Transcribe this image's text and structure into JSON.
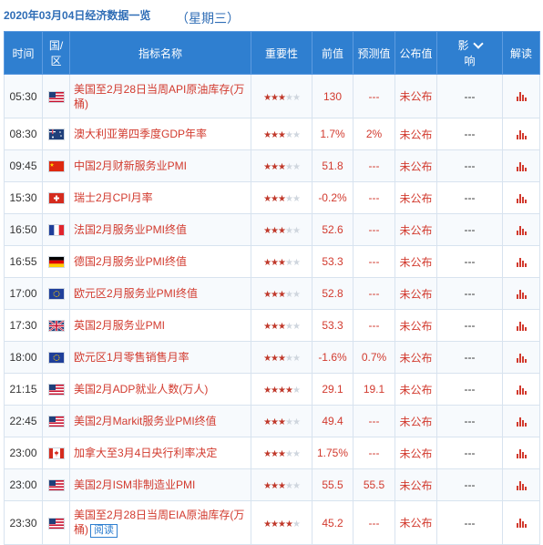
{
  "header": {
    "date": "2020年03月04日经济数据一览",
    "weekday": "（星期三）"
  },
  "columns": {
    "time": "时间",
    "country_l1": "国/",
    "country_l2": "区",
    "indicator": "指标名称",
    "importance": "重要性",
    "previous": "前值",
    "forecast": "预测值",
    "actual": "公布值",
    "impact_l1": "影",
    "impact_l2": "响",
    "interpret": "解读"
  },
  "rows": [
    {
      "time": "05:30",
      "country": "us",
      "name": "美国至2月28日当周API原油库存(万桶)",
      "stars": 3,
      "prev": "130",
      "forecast": "---",
      "actual": "未公布",
      "impact": "---"
    },
    {
      "time": "08:30",
      "country": "au",
      "name": "澳大利亚第四季度GDP年率",
      "stars": 3,
      "prev": "1.7%",
      "forecast": "2%",
      "actual": "未公布",
      "impact": "---"
    },
    {
      "time": "09:45",
      "country": "cn",
      "name": "中国2月财新服务业PMI",
      "stars": 3,
      "prev": "51.8",
      "forecast": "---",
      "actual": "未公布",
      "impact": "---"
    },
    {
      "time": "15:30",
      "country": "ch",
      "name": "瑞士2月CPI月率",
      "stars": 3,
      "prev": "-0.2%",
      "forecast": "---",
      "actual": "未公布",
      "impact": "---"
    },
    {
      "time": "16:50",
      "country": "fr",
      "name": "法国2月服务业PMI终值",
      "stars": 3,
      "prev": "52.6",
      "forecast": "---",
      "actual": "未公布",
      "impact": "---"
    },
    {
      "time": "16:55",
      "country": "de",
      "name": "德国2月服务业PMI终值",
      "stars": 3,
      "prev": "53.3",
      "forecast": "---",
      "actual": "未公布",
      "impact": "---"
    },
    {
      "time": "17:00",
      "country": "eu",
      "name": "欧元区2月服务业PMI终值",
      "stars": 3,
      "prev": "52.8",
      "forecast": "---",
      "actual": "未公布",
      "impact": "---"
    },
    {
      "time": "17:30",
      "country": "gb",
      "name": "英国2月服务业PMI",
      "stars": 3,
      "prev": "53.3",
      "forecast": "---",
      "actual": "未公布",
      "impact": "---"
    },
    {
      "time": "18:00",
      "country": "eu",
      "name": "欧元区1月零售销售月率",
      "stars": 3,
      "prev": "-1.6%",
      "forecast": "0.7%",
      "actual": "未公布",
      "impact": "---"
    },
    {
      "time": "21:15",
      "country": "us",
      "name": "美国2月ADP就业人数(万人)",
      "stars": 4,
      "prev": "29.1",
      "forecast": "19.1",
      "actual": "未公布",
      "impact": "---"
    },
    {
      "time": "22:45",
      "country": "us",
      "name": "美国2月Markit服务业PMI终值",
      "stars": 3,
      "prev": "49.4",
      "forecast": "---",
      "actual": "未公布",
      "impact": "---"
    },
    {
      "time": "23:00",
      "country": "ca",
      "name": "加拿大至3月4日央行利率决定",
      "stars": 3,
      "prev": "1.75%",
      "forecast": "---",
      "actual": "未公布",
      "impact": "---"
    },
    {
      "time": "23:00",
      "country": "us",
      "name": "美国2月ISM非制造业PMI",
      "stars": 3,
      "prev": "55.5",
      "forecast": "55.5",
      "actual": "未公布",
      "impact": "---"
    },
    {
      "time": "23:30",
      "country": "us",
      "name": "美国至2月28日当周EIA原油库存(万桶)",
      "stars": 4,
      "prev": "45.2",
      "forecast": "---",
      "actual": "未公布",
      "impact": "---",
      "button": "阅读"
    }
  ],
  "colors": {
    "header_bg": "#2f7fd0",
    "accent_red": "#d23a2e",
    "star_on": "#c0392b",
    "star_off": "#cfd6de",
    "title_blue": "#2f6db6"
  }
}
